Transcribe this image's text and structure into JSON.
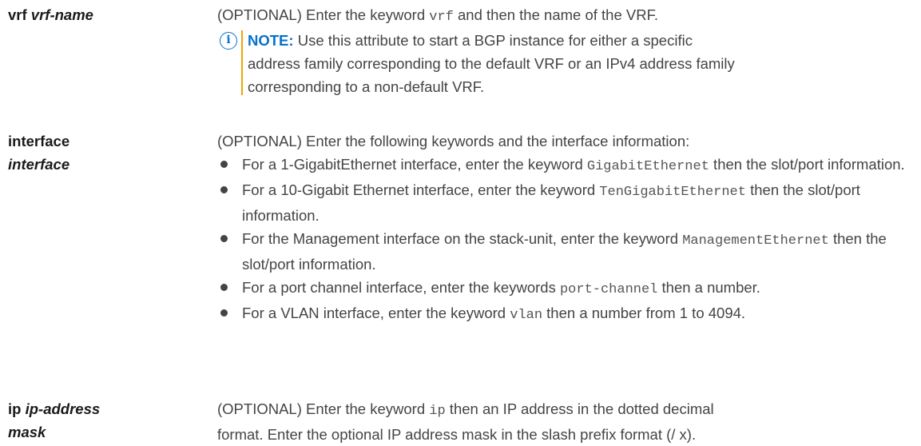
{
  "rows": [
    {
      "term_keyword": "vrf",
      "term_arg": "vrf-name",
      "def_prefix": "(OPTIONAL) Enter the keyword ",
      "def_code": "vrf",
      "def_suffix": " and then the name of the VRF.",
      "note_label": "NOTE:",
      "note_line1": " Use this attribute to start a BGP instance for either a specific",
      "note_line2": "address family corresponding to the default VRF or an IPv4 address family",
      "note_line3": "corresponding to a non-default VRF."
    },
    {
      "term_keyword": "interface",
      "term_arg": "interface",
      "intro": "(OPTIONAL) Enter the following keywords and the interface information:",
      "items": [
        {
          "pre": "For a 1-GigabitEthernet interface, enter the keyword ",
          "code": "GigabitEthernet",
          "post": " then the slot/port information."
        },
        {
          "pre": "For a 10-Gigabit Ethernet interface, enter the keyword ",
          "code": "TenGigabitEthernet",
          "post": " then the slot/port information."
        },
        {
          "pre": "For the Management interface on the stack-unit, enter the keyword ",
          "code": "ManagementEthernet",
          "post": " then the slot/port information."
        },
        {
          "pre": "For a port channel interface, enter the keywords ",
          "code": "port-channel",
          "post": " then a number."
        },
        {
          "pre": "For a VLAN interface, enter the keyword ",
          "code": "vlan",
          "post": " then a number from 1 to 4094."
        }
      ]
    },
    {
      "term_keyword": "ip",
      "term_arg1": "ip-address",
      "term_arg2": "mask",
      "def_prefix": "(OPTIONAL) Enter the keyword ",
      "def_code": "ip",
      "def_suffix": " then an IP address in the dotted decimal",
      "def_line2": "format. Enter the optional IP address mask in the slash prefix format (/ x)."
    }
  ]
}
